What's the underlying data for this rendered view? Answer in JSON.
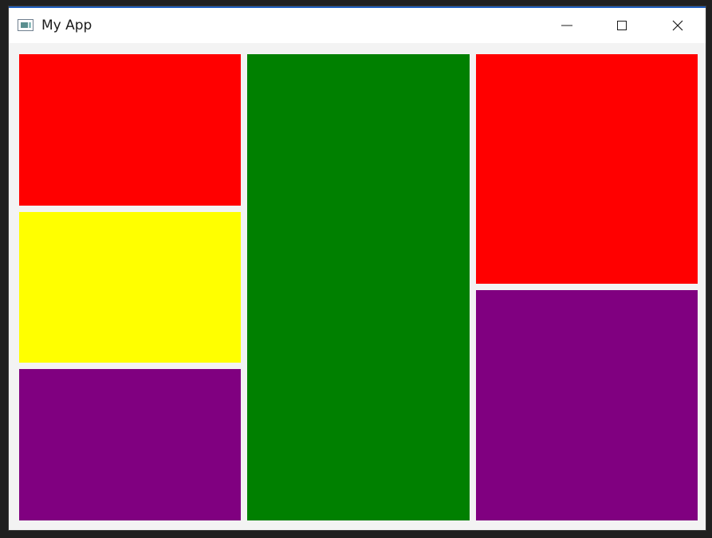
{
  "window": {
    "title": "My App",
    "controls": {
      "minimize_icon": "minimize-icon",
      "maximize_icon": "maximize-icon",
      "close_icon": "close-icon"
    }
  },
  "panels": {
    "left": [
      {
        "name": "left-top-panel",
        "color": "#ff0000"
      },
      {
        "name": "left-middle-panel",
        "color": "#ffff00"
      },
      {
        "name": "left-bottom-panel",
        "color": "#800080"
      }
    ],
    "center": [
      {
        "name": "center-panel",
        "color": "#008000"
      }
    ],
    "right": [
      {
        "name": "right-top-panel",
        "color": "#ff0000"
      },
      {
        "name": "right-bottom-panel",
        "color": "#800080"
      }
    ]
  }
}
